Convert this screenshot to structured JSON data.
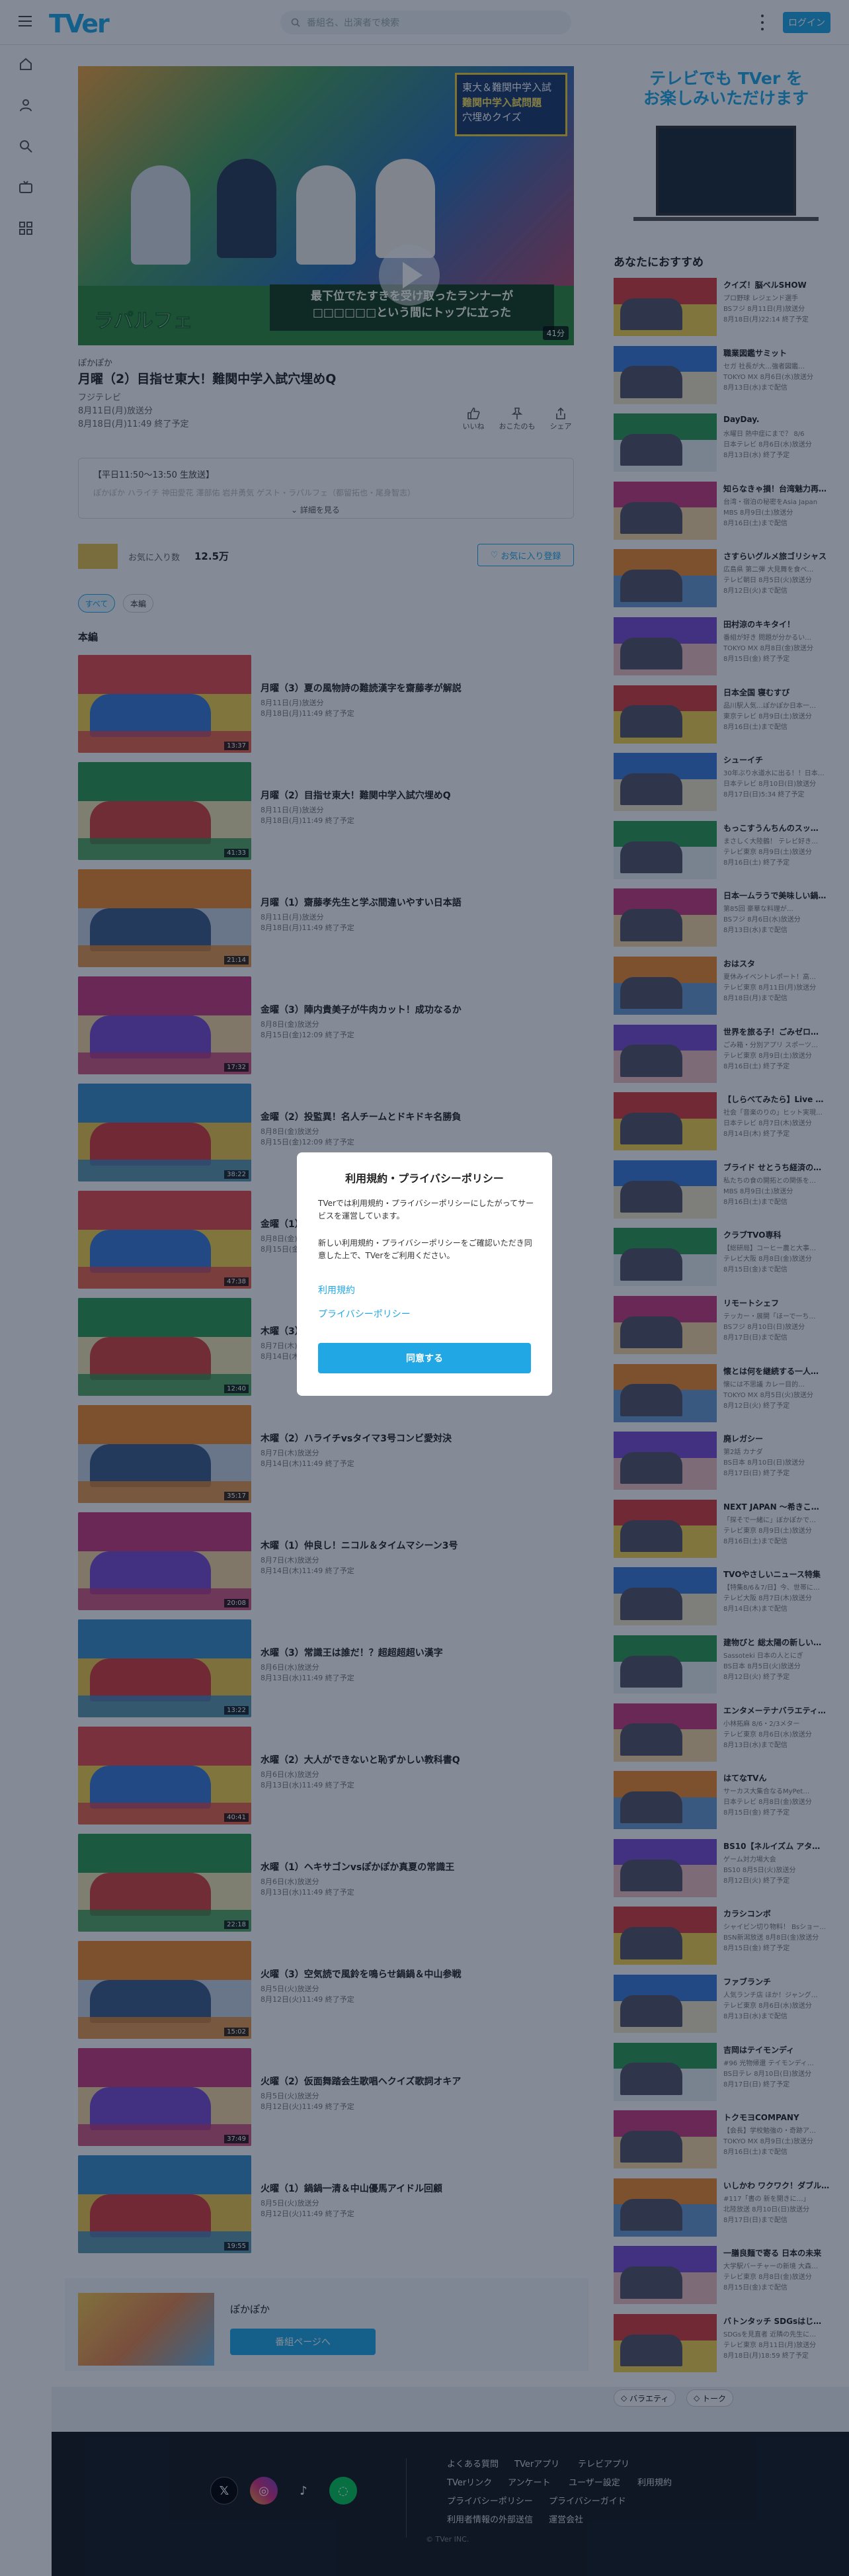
{
  "header": {
    "logo": "TVer",
    "search_placeholder": "番組名、出演者で検索",
    "login_label": "ログイン"
  },
  "player": {
    "caption_line1": "最下位でたすきを受け取ったランナーが",
    "caption_line2": "□□□□□□という間にトップに立った",
    "quiz_line1": "東大＆難関中学入試",
    "quiz_line2": "難関中学入試問題",
    "quiz_line3": "穴埋めクイズ",
    "show_logo": "ラパルフェ",
    "duration": "41分"
  },
  "episode": {
    "series": "ぽかぽか",
    "title": "月曜（2）目指せ東大！難関中学入試穴埋めQ",
    "station": "フジテレビ",
    "aired": "8月11日(月)放送分",
    "expires": "8月18日(月)11:49 終了予定",
    "actions": [
      "いいね",
      "おこたのも",
      "シェア"
    ],
    "description": "【平日11:50〜13:50 生放送】",
    "description_more": "ぽかぽか ハライチ 神田愛花 澤部佑 岩井勇気 ゲスト・ラパルフェ（都留拓也・尾身智志）",
    "more_label": "詳細を見る"
  },
  "favorites": {
    "label": "お気に入り数",
    "count": "12.5万",
    "button": "お気に入り登録"
  },
  "filters": [
    "すべて",
    "本編"
  ],
  "list_heading": "本編",
  "episodes": [
    {
      "title": "月曜（3）夏の風物詩の難読漢字を齋藤孝が解説",
      "aired": "8月11日(月)放送分",
      "expires": "8月18日(月)11:49 終了予定",
      "duration": "13:37"
    },
    {
      "title": "月曜（2）目指せ東大！難関中学入試穴埋めQ",
      "aired": "8月11日(月)放送分",
      "expires": "8月18日(月)11:49 終了予定",
      "duration": "41:33"
    },
    {
      "title": "月曜（1）齋藤孝先生と学ぶ間違いやすい日本語",
      "aired": "8月11日(月)放送分",
      "expires": "8月18日(月)11:49 終了予定",
      "duration": "21:14"
    },
    {
      "title": "金曜（3）陣内貴美子が牛肉カット！成功なるか",
      "aired": "8月8日(金)放送分",
      "expires": "8月15日(金)12:09 終了予定",
      "duration": "17:32"
    },
    {
      "title": "金曜（2）投監異！名人チームとドキドキ名勝負",
      "aired": "8月8日(金)放送分",
      "expires": "8月15日(金)12:09 終了予定",
      "duration": "38:22"
    },
    {
      "title": "金曜（1）ドリ大活躍",
      "aired": "8月8日(金)放送分",
      "expires": "8月15日(金)12:09 終了予定",
      "duration": "47:38"
    },
    {
      "title": "木曜（3）",
      "aired": "8月7日(木)放送分",
      "expires": "8月14日(木)11:49 終了予定",
      "duration": "12:40"
    },
    {
      "title": "木曜（2）ハライチvsタイマ3号コンビ愛対決",
      "aired": "8月7日(木)放送分",
      "expires": "8月14日(木)11:49 終了予定",
      "duration": "35:17"
    },
    {
      "title": "木曜（1）仲良し！ニコル＆タイムマシーン3号",
      "aired": "8月7日(木)放送分",
      "expires": "8月14日(木)11:49 終了予定",
      "duration": "20:08"
    },
    {
      "title": "水曜（3）常識王は誰だ！？超超超超い漢字",
      "aired": "8月6日(水)放送分",
      "expires": "8月13日(水)11:49 終了予定",
      "duration": "13:22"
    },
    {
      "title": "水曜（2）大人ができないと恥ずかしい教科書Q",
      "aired": "8月6日(水)放送分",
      "expires": "8月13日(水)11:49 終了予定",
      "duration": "40:41"
    },
    {
      "title": "水曜（1）ヘキサゴンvsぽかぽか真夏の常識王",
      "aired": "8月6日(水)放送分",
      "expires": "8月13日(水)11:49 終了予定",
      "duration": "22:18"
    },
    {
      "title": "火曜（3）空気読で風鈴を鳴らせ鍋鍋＆中山参戦",
      "aired": "8月5日(火)放送分",
      "expires": "8月12日(火)11:49 終了予定",
      "duration": "15:02"
    },
    {
      "title": "火曜（2）仮面舞踏会生歌唱ヘクイズ歌詞オキア",
      "aired": "8月5日(火)放送分",
      "expires": "8月12日(火)11:49 終了予定",
      "duration": "37:49"
    },
    {
      "title": "火曜（1）鍋鍋一清＆中山優馬アイドル回顧",
      "aired": "8月5日(火)放送分",
      "expires": "8月12日(火)11:49 終了予定",
      "duration": "19:55"
    }
  ],
  "banner": {
    "title": "ぽかぽか",
    "button": "番組ページへ"
  },
  "ad": {
    "line1": "テレビでも TVer を",
    "line2": "お楽しみいただけます"
  },
  "recommend_heading": "あなたにおすすめ",
  "recommendations": [
    {
      "title": "クイズ！脳ベルSHOW",
      "sub": "プロ野球 レジェンド選手",
      "date": "BSフジ 8月11日(月)放送分",
      "expires": "8月18日(月)22:14 終了予定"
    },
    {
      "title": "職業図鑑サミット",
      "sub": "セガ 社長が大…強者図鑑…",
      "date": "TOKYO MX 8月6日(水)放送分",
      "expires": "8月13日(水)まで配信"
    },
    {
      "title": "DayDay.",
      "sub": "水曜日 熱中症にまで？ 8/6",
      "date": "日本テレビ 8月6日(水)放送分",
      "expires": "8月13日(水) 終了予定"
    },
    {
      "title": "知らなきゃ損！台湾魅力再…",
      "sub": "台湾・宿泊の秘密をAsia Japan",
      "date": "MBS 8月9日(土)放送分",
      "expires": "8月16日(土)まで配信"
    },
    {
      "title": "さすらいグルメ旅ゴリシャス",
      "sub": "広島県 第二弾 大見舞を食べ…",
      "date": "テレビ朝日 8月5日(火)放送分",
      "expires": "8月12日(火)まで配信"
    },
    {
      "title": "田村涼のキキタイ！",
      "sub": "番組が好き 問題が分かるい…",
      "date": "TOKYO MX 8月8日(金)放送分",
      "expires": "8月15日(金) 終了予定"
    },
    {
      "title": "日本全国 寝むすび",
      "sub": "品川駅人気…ぽかぽか日本一…",
      "date": "東京テレビ 8月9日(土)放送分",
      "expires": "8月16日(土)まで配信"
    },
    {
      "title": "シューイチ",
      "sub": "30年ぶり水道水に出る！！日本…",
      "date": "日本テレビ 8月10日(日)放送分",
      "expires": "8月17日(日)5:34 終了予定"
    },
    {
      "title": "もっこすうんちんのスッ…",
      "sub": "まさしく大陸鶴！ テレビ好き…",
      "date": "テレビ東京 8月9日(土)放送分",
      "expires": "8月16日(土) 終了予定"
    },
    {
      "title": "日本一ムラうで美味しい鍋…",
      "sub": "第85回 豪華な料理が…",
      "date": "BSフジ 8月6日(水)放送分",
      "expires": "8月13日(水)まで配信"
    },
    {
      "title": "おはスタ",
      "sub": "夏休みイベントレポート！高…",
      "date": "テレビ東京 8月11日(月)放送分",
      "expires": "8月18日(月)まで配信"
    },
    {
      "title": "世界を旅る子！ごみゼロ…",
      "sub": "ごみ箱・分別アプリ スポーツ…",
      "date": "テレビ東京 8月9日(土)放送分",
      "expires": "8月16日(土) 終了予定"
    },
    {
      "title": "【しらべてみたら】Live …",
      "sub": "社会「音楽のりの」ヒット実現…",
      "date": "日本テレビ 8月7日(木)放送分",
      "expires": "8月14日(木) 終了予定"
    },
    {
      "title": "ブライド せとうち経済の…",
      "sub": "私たちの食の開拓との関係を…",
      "date": "MBS 8月9日(土)放送分",
      "expires": "8月16日(土)まで配信"
    },
    {
      "title": "クラブTVO専科",
      "sub": "【総研局】コーヒー農と大事…",
      "date": "テレビ大阪 8月8日(金)放送分",
      "expires": "8月15日(金)まで配信"
    },
    {
      "title": "リモートシェフ",
      "sub": "テッカー・展開「ほーで一ち…",
      "date": "BSフジ 8月10日(日)放送分",
      "expires": "8月17日(日)まで配信"
    },
    {
      "title": "懐とは何を継続する一人…",
      "sub": "懐には不思議 カレー目的…",
      "date": "TOKYO MX 8月5日(火)放送分",
      "expires": "8月12日(火) 終了予定"
    },
    {
      "title": "廃レガシー",
      "sub": "第2話 カナダ",
      "date": "BS日本 8月10日(日)放送分",
      "expires": "8月17日(日) 終了予定"
    },
    {
      "title": "NEXT JAPAN 〜希きこ…",
      "sub": "「探そで一緒に」ぼかぽかで…",
      "date": "テレビ東京 8月9日(土)放送分",
      "expires": "8月16日(土)まで配信"
    },
    {
      "title": "TVOやさしいニュース特集",
      "sub": "【特集8/6＆7/日】今、世帯に…",
      "date": "テレビ大阪 8月7日(木)放送分",
      "expires": "8月14日(木)まで配信"
    },
    {
      "title": "建物びと 総太陽の新しい…",
      "sub": "Sassoteki 日本の人とにぎ",
      "date": "BS日本 8月5日(火)放送分",
      "expires": "8月12日(火) 終了予定"
    },
    {
      "title": "エンタメーテナバラエティ…",
      "sub": "小林拓麻 8/6・2/3メター",
      "date": "テレビ東京 8月6日(水)放送分",
      "expires": "8月13日(水)まで配信"
    },
    {
      "title": "はてなTVん",
      "sub": "サーカス大集合なるMyPet…",
      "date": "日本テレビ 8月8日(金)放送分",
      "expires": "8月15日(金) 終了予定"
    },
    {
      "title": "BS10【ネルイズム アタ…",
      "sub": "ゲーム対力場大会",
      "date": "BS10 8月5日(火)放送分",
      "expires": "8月12日(火) 終了予定"
    },
    {
      "title": "カラシコンボ",
      "sub": "シャイビン切り物料！ Bsショー…",
      "date": "BSN新潟放送 8月8日(金)放送分",
      "expires": "8月15日(金) 終了予定"
    },
    {
      "title": "ファブランチ",
      "sub": "人気ランチ店 ほか！ジャング…",
      "date": "テレビ東京 8月6日(水)放送分",
      "expires": "8月13日(水)まで配信"
    },
    {
      "title": "吉岡はテイモンディ",
      "sub": "#96 光物帰還 テイモンディ…",
      "date": "BS日テレ 8月10日(日)放送分",
      "expires": "8月17日(日) 終了予定"
    },
    {
      "title": "トクモヨCOMPANY",
      "sub": "【会長】学校勉強の・奇跡ア…",
      "date": "TOKYO MX 8月9日(土)放送分",
      "expires": "8月16日(土)まで配信"
    },
    {
      "title": "いしかわ ワクワク！ダブル…",
      "sub": "#117「書の 新を開きに…」",
      "date": "北陸放送 8月10日(日)放送分",
      "expires": "8月17日(日)まで配信"
    },
    {
      "title": "一膳良麺で寄る 日本の未来",
      "sub": "大学駅バーチャーの新境 大森…",
      "date": "テレビ東京 8月8日(金)放送分",
      "expires": "8月15日(金)まで配信"
    },
    {
      "title": "バトンタッチ SDGsはじ…",
      "sub": "SDGsを見直者 近隣の先生に…",
      "date": "テレビ東京 8月11日(月)放送分",
      "expires": "8月18日(月)18:59 終了予定"
    }
  ],
  "tags": [
    "バラエティ",
    "トーク"
  ],
  "footer": {
    "social": [
      "X",
      "Instagram",
      "TikTok",
      "LINE"
    ],
    "links_row1": [
      "よくある質問",
      "TVerアプリ",
      "テレビアプリ"
    ],
    "links_row2": [
      "TVerリンク",
      "アンケート",
      "ユーザー設定",
      "利用規約"
    ],
    "links_row3": [
      "プライバシーポリシー",
      "プライバシーガイド"
    ],
    "links_row4": [
      "利用者情報の外部送信",
      "運営会社"
    ],
    "copyright": "© TVer INC."
  },
  "modal": {
    "title": "利用規約・プライバシーポリシー",
    "p1": "TVerでは利用規約・プライバシーポリシーにしたがってサービスを運営しています。",
    "p2": "新しい利用規約・プライバシーポリシーをご確認いただき同意した上で、TVerをご利用ください。",
    "link1": "利用規約",
    "link2": "プライバシーポリシー",
    "agree": "同意する"
  },
  "colors": {
    "accent": "#21a8e4",
    "overlay": "rgba(10,24,48,0.5)",
    "footer": "#15171b"
  }
}
